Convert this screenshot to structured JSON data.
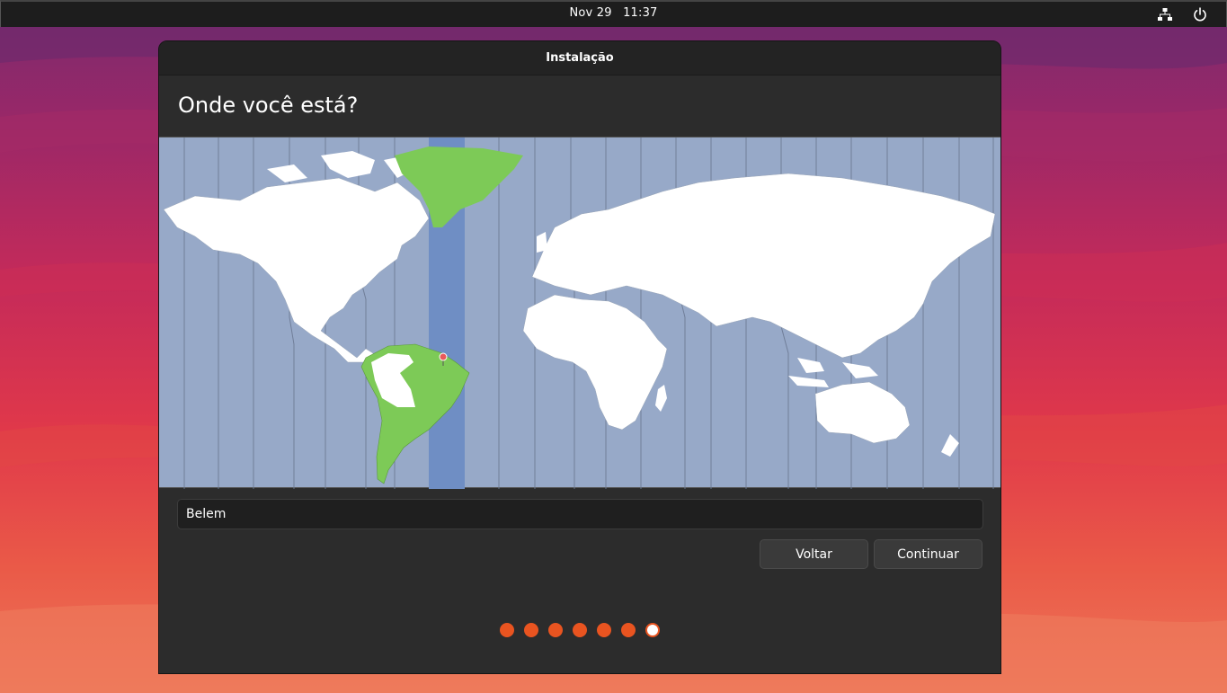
{
  "topbar": {
    "date": "Nov 29",
    "time": "11:37",
    "icons": [
      "network-icon",
      "power-icon"
    ]
  },
  "window": {
    "title": "Instalação",
    "heading": "Onde você está?"
  },
  "map": {
    "selected_city": "Belem",
    "highlight_color": "#7dca57",
    "timezone_band_color": "#6f8ec4",
    "ocean_color": "#97a9c8",
    "pin_color": "#e95a5a"
  },
  "location_field": {
    "value": "Belem"
  },
  "buttons": {
    "back_label": "Voltar",
    "continue_label": "Continuar"
  },
  "progress": {
    "total_steps": 7,
    "current_step": 7
  },
  "colors": {
    "accent": "#e95420",
    "window_bg": "#2c2c2c",
    "titlebar_bg": "#232323"
  }
}
